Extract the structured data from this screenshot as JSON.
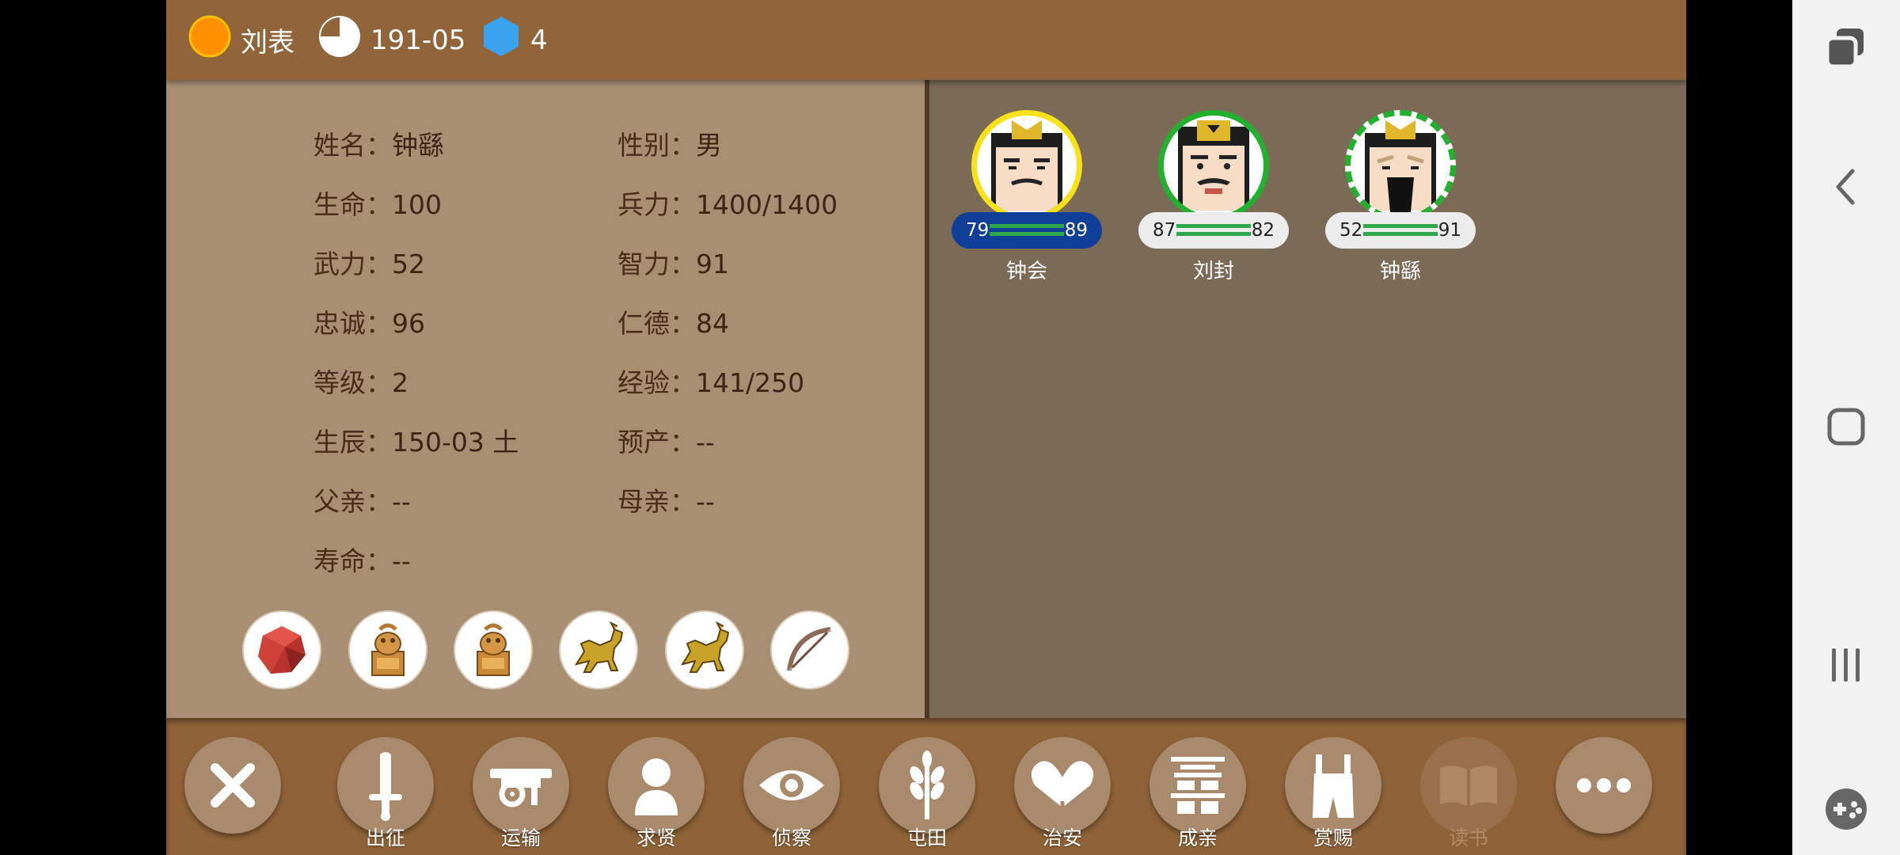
{
  "header": {
    "lord_name": "刘表",
    "date": "191-05",
    "resource_count": "4"
  },
  "general": {
    "fields": [
      {
        "key": "姓名",
        "value": "钟繇"
      },
      {
        "key": "性别",
        "value": "男"
      },
      {
        "key": "生命",
        "value": "100"
      },
      {
        "key": "兵力",
        "value": "1400/1400"
      },
      {
        "key": "武力",
        "value": "52"
      },
      {
        "key": "智力",
        "value": "91"
      },
      {
        "key": "忠诚",
        "value": "96"
      },
      {
        "key": "仁德",
        "value": "84"
      },
      {
        "key": "等级",
        "value": "2"
      },
      {
        "key": "经验",
        "value": "141/250"
      },
      {
        "key": "生辰",
        "value": "150-03 土"
      },
      {
        "key": "预产",
        "value": "--"
      },
      {
        "key": "父亲",
        "value": "--"
      },
      {
        "key": "母亲",
        "value": "--"
      },
      {
        "key": "寿命",
        "value": "--"
      }
    ],
    "separator": "：",
    "items": [
      "red-gem-icon",
      "golden-seal-icon",
      "golden-seal-icon",
      "golden-horse-icon",
      "golden-horse-icon",
      "bow-icon"
    ]
  },
  "roster": [
    {
      "name": "钟会",
      "left_stat": "79",
      "right_stat": "89",
      "selected": true
    },
    {
      "name": "刘封",
      "left_stat": "87",
      "right_stat": "82",
      "selected": false
    },
    {
      "name": "钟繇",
      "left_stat": "52",
      "right_stat": "91",
      "selected": false
    }
  ],
  "actions": [
    {
      "label": "出征",
      "icon": "sword-icon"
    },
    {
      "label": "运输",
      "icon": "cart-icon"
    },
    {
      "label": "求贤",
      "icon": "person-icon"
    },
    {
      "label": "侦察",
      "icon": "eye-icon"
    },
    {
      "label": "屯田",
      "icon": "wheat-icon"
    },
    {
      "label": "治安",
      "icon": "heart-hands-icon"
    },
    {
      "label": "成亲",
      "icon": "double-happiness-icon"
    },
    {
      "label": "赏赐",
      "icon": "overalls-icon"
    },
    {
      "label": "读书",
      "icon": "book-icon",
      "disabled": true
    }
  ],
  "colors": {
    "frame_brown": "#91643a",
    "panel_tan": "#a88f73",
    "roster_brown": "#7b6a55",
    "selected_pill": "#0f3f96",
    "ring_yellow": "#f7e21a",
    "ring_green": "#22b12e"
  }
}
